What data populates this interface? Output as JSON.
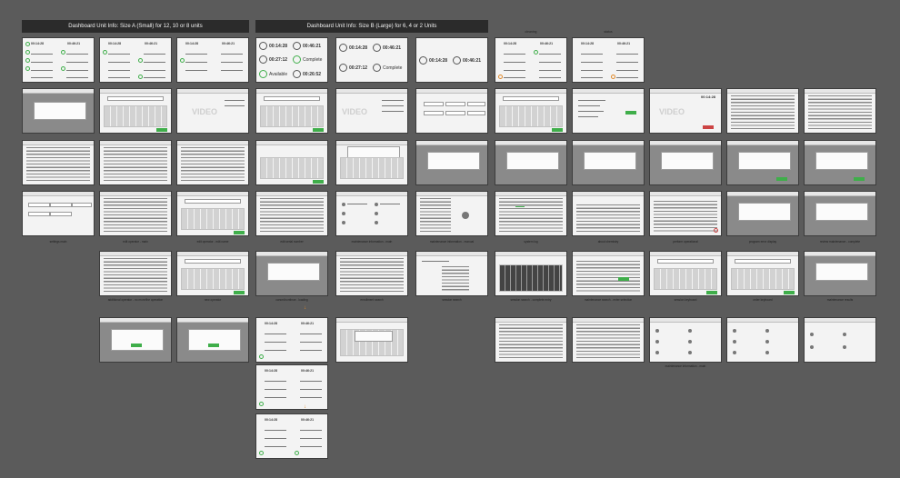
{
  "banners": {
    "small": "Dashboard Unit Info: Size A (Small) for 12, 10 or 8 units",
    "large": "Dashboard Unit Info: Size B (Large) for 6, 4 or 2 Units"
  },
  "top_labels": [
    "cleaning",
    "status"
  ],
  "thumbs": {
    "time_a": "00:14:28",
    "time_b": "00:46:21",
    "time_c": "00:27:12",
    "time_d": "00:26:52",
    "status_complete": "Complete",
    "status_available": "Available",
    "video": "VIDEO"
  },
  "captions": [
    "settings main",
    "edit operator - main",
    "edit operator - edit name",
    "edit serial number",
    "maintenance information - main",
    "maintenance information - manual",
    "system log",
    "about chemistry",
    "perform operational",
    "program error display",
    "review maintenance - complete",
    "additional operator - no more/the operation",
    "new operator",
    "cancel/continue - loading",
    "enrollment search",
    "session search",
    "session search - complete entry",
    "maintenance search - enter selection",
    "session keyboard",
    "order keyboard",
    "maintenance results",
    "maintenance information - main"
  ]
}
